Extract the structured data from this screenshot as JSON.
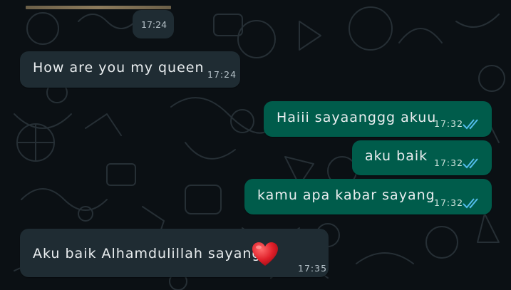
{
  "colors": {
    "background": "#0b1014",
    "incoming_bubble": "#1f2c33",
    "outgoing_bubble": "#005c4b",
    "read_ticks": "#53bdeb",
    "doodle": "#2a333a"
  },
  "media_message": {
    "time": "17:24"
  },
  "messages": [
    {
      "direction": "incoming",
      "text": "How are you my queen",
      "time": "17:24"
    },
    {
      "direction": "outgoing",
      "text": "Haiii sayaanggg akuu",
      "time": "17:32",
      "status": "read-double-check-icon"
    },
    {
      "direction": "outgoing",
      "text": "aku baik",
      "time": "17:32",
      "status": "read-double-check-icon"
    },
    {
      "direction": "outgoing",
      "text": "kamu apa kabar sayang",
      "time": "17:32",
      "status": "read-double-check-icon"
    },
    {
      "direction": "incoming",
      "text": "Aku baik Alhamdulillah sayang",
      "emoji": "red-heart-icon",
      "time": "17:35"
    }
  ]
}
